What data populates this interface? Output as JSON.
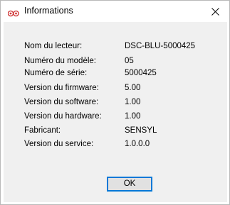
{
  "window": {
    "title": "Informations",
    "icon": "sensyl-logo-icon",
    "close_icon": "close-icon"
  },
  "fields": [
    {
      "label": "Nom du lecteur:",
      "value": "DSC-BLU-5000425"
    },
    {
      "label": "Numéro du modèle:",
      "value": "05"
    },
    {
      "label": "Numéro de série:",
      "value": "5000425"
    },
    {
      "label": "Version du firmware:",
      "value": "5.00"
    },
    {
      "label": "Version du software:",
      "value": "1.00"
    },
    {
      "label": "Version du hardware:",
      "value": "1.00"
    },
    {
      "label": "Fabricant:",
      "value": "SENSYL"
    },
    {
      "label": "Version du service:",
      "value": "1.0.0.0"
    }
  ],
  "buttons": {
    "ok_label": "OK"
  },
  "colors": {
    "focus_border": "#0078d7",
    "client_bg": "#f0f0f0",
    "button_bg": "#e1e1e1",
    "icon_red": "#d13b3b"
  }
}
